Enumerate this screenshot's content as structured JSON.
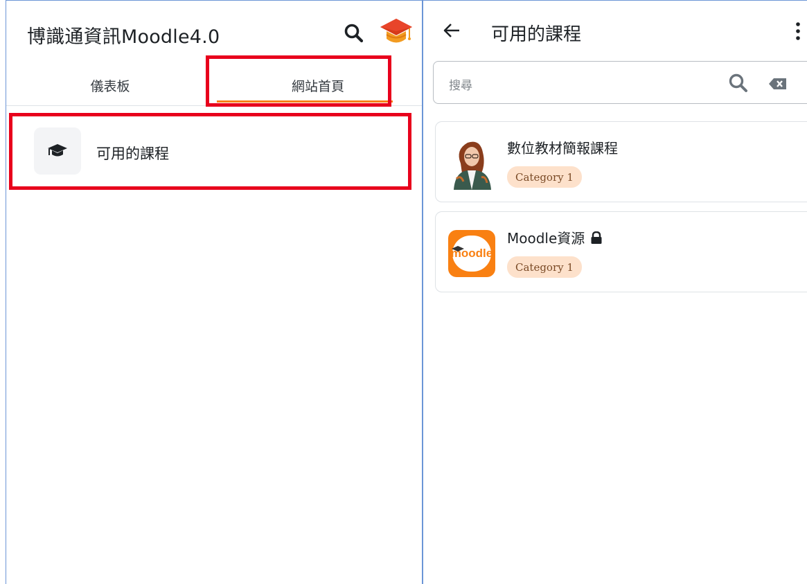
{
  "left": {
    "app_title": "博識通資訊Moodle4.0",
    "header_icons": [
      "search-icon",
      "graduation-cap-icon"
    ],
    "tabs": [
      {
        "label": "儀表板",
        "active": false
      },
      {
        "label": "網站首頁",
        "active": true
      }
    ],
    "course_link": {
      "icon": "graduation-cap-icon",
      "label": "可用的課程"
    }
  },
  "right": {
    "title": "可用的課程",
    "search": {
      "placeholder": "搜尋"
    },
    "courses": [
      {
        "name": "數位教材簡報課程",
        "category": "Category 1",
        "locked": false,
        "thumb": "teacher-photo"
      },
      {
        "name": "Moodle資源",
        "category": "Category 1",
        "locked": true,
        "thumb": "moodle-logo",
        "logo_text": "moodle"
      }
    ]
  },
  "colors": {
    "accent": "#f98012",
    "highlight": "#e8001c",
    "badge_bg": "#fde1cb",
    "divider": "#6b95d6"
  }
}
